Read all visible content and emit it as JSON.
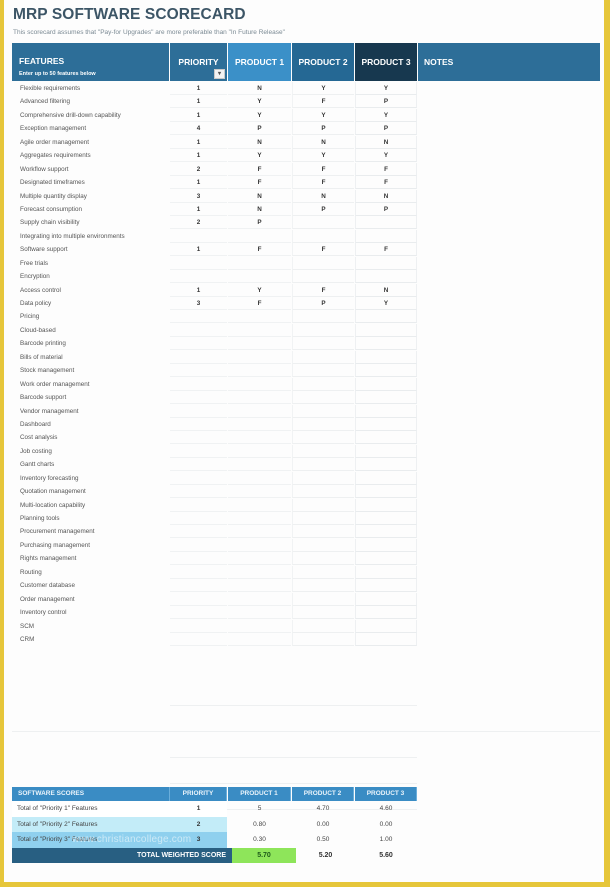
{
  "title": "MRP SOFTWARE SCORECARD",
  "subtitle": "This scorecard assumes that \"Pay-for Upgrades\" are more preferable than \"In Future Release\"",
  "header": {
    "features": "FEATURES",
    "features_sub": "Enter up to 50 features below",
    "priority": "PRIORITY",
    "filter_icon": "▾",
    "product1": "PRODUCT 1",
    "product2": "PRODUCT 2",
    "product3": "PRODUCT 3",
    "notes": "NOTES"
  },
  "colors": {
    "header_blue": "#2d6e98",
    "product1_blue": "#3b90c8",
    "product2_blue": "#256894",
    "product3_navy": "#17384f",
    "winner_green": "#8ee55a",
    "frame_yellow": "#e6c63a"
  },
  "features": [
    {
      "name": "Flexible requirements",
      "priority": "1",
      "p1": "N",
      "p2": "Y",
      "p3": "Y"
    },
    {
      "name": "Advanced filtering",
      "priority": "1",
      "p1": "Y",
      "p2": "F",
      "p3": "P"
    },
    {
      "name": "Comprehensive drill-down capability",
      "priority": "1",
      "p1": "Y",
      "p2": "Y",
      "p3": "Y"
    },
    {
      "name": "Exception management",
      "priority": "4",
      "p1": "P",
      "p2": "P",
      "p3": "P"
    },
    {
      "name": "Agile order management",
      "priority": "1",
      "p1": "N",
      "p2": "N",
      "p3": "N"
    },
    {
      "name": "Aggregates requirements",
      "priority": "1",
      "p1": "Y",
      "p2": "Y",
      "p3": "Y"
    },
    {
      "name": "Workflow support",
      "priority": "2",
      "p1": "F",
      "p2": "F",
      "p3": "F"
    },
    {
      "name": "Designated timeframes",
      "priority": "1",
      "p1": "F",
      "p2": "F",
      "p3": "F"
    },
    {
      "name": "Multiple quantity display",
      "priority": "3",
      "p1": "N",
      "p2": "N",
      "p3": "N"
    },
    {
      "name": "Forecast consumption",
      "priority": "1",
      "p1": "N",
      "p2": "P",
      "p3": "P"
    },
    {
      "name": "Supply chain visibility",
      "priority": "2",
      "p1": "P",
      "p2": "",
      "p3": ""
    },
    {
      "name": "Integrating into multiple environments",
      "priority": "",
      "p1": "",
      "p2": "",
      "p3": ""
    },
    {
      "name": "Software support",
      "priority": "1",
      "p1": "F",
      "p2": "F",
      "p3": "F"
    },
    {
      "name": "Free trials",
      "priority": "",
      "p1": "",
      "p2": "",
      "p3": ""
    },
    {
      "name": "Encryption",
      "priority": "",
      "p1": "",
      "p2": "",
      "p3": ""
    },
    {
      "name": "Access control",
      "priority": "1",
      "p1": "Y",
      "p2": "F",
      "p3": "N"
    },
    {
      "name": "Data policy",
      "priority": "3",
      "p1": "F",
      "p2": "P",
      "p3": "Y"
    },
    {
      "name": "Pricing",
      "priority": "",
      "p1": "",
      "p2": "",
      "p3": ""
    },
    {
      "name": "Cloud-based",
      "priority": "",
      "p1": "",
      "p2": "",
      "p3": ""
    },
    {
      "name": "Barcode printing",
      "priority": "",
      "p1": "",
      "p2": "",
      "p3": ""
    },
    {
      "name": "Bills of material",
      "priority": "",
      "p1": "",
      "p2": "",
      "p3": ""
    },
    {
      "name": "Stock management",
      "priority": "",
      "p1": "",
      "p2": "",
      "p3": ""
    },
    {
      "name": "Work order management",
      "priority": "",
      "p1": "",
      "p2": "",
      "p3": ""
    },
    {
      "name": "Barcode support",
      "priority": "",
      "p1": "",
      "p2": "",
      "p3": ""
    },
    {
      "name": "Vendor management",
      "priority": "",
      "p1": "",
      "p2": "",
      "p3": ""
    },
    {
      "name": "Dashboard",
      "priority": "",
      "p1": "",
      "p2": "",
      "p3": ""
    },
    {
      "name": "Cost analysis",
      "priority": "",
      "p1": "",
      "p2": "",
      "p3": ""
    },
    {
      "name": "Job costing",
      "priority": "",
      "p1": "",
      "p2": "",
      "p3": ""
    },
    {
      "name": "Gantt charts",
      "priority": "",
      "p1": "",
      "p2": "",
      "p3": ""
    },
    {
      "name": "Inventory forecasting",
      "priority": "",
      "p1": "",
      "p2": "",
      "p3": ""
    },
    {
      "name": "Quotation management",
      "priority": "",
      "p1": "",
      "p2": "",
      "p3": ""
    },
    {
      "name": "Multi-location capability",
      "priority": "",
      "p1": "",
      "p2": "",
      "p3": ""
    },
    {
      "name": "Planning tools",
      "priority": "",
      "p1": "",
      "p2": "",
      "p3": ""
    },
    {
      "name": "Procurement management",
      "priority": "",
      "p1": "",
      "p2": "",
      "p3": ""
    },
    {
      "name": "Purchasing management",
      "priority": "",
      "p1": "",
      "p2": "",
      "p3": ""
    },
    {
      "name": "Rights management",
      "priority": "",
      "p1": "",
      "p2": "",
      "p3": ""
    },
    {
      "name": "Routing",
      "priority": "",
      "p1": "",
      "p2": "",
      "p3": ""
    },
    {
      "name": "Customer database",
      "priority": "",
      "p1": "",
      "p2": "",
      "p3": ""
    },
    {
      "name": "Order management",
      "priority": "",
      "p1": "",
      "p2": "",
      "p3": ""
    },
    {
      "name": "Inventory control",
      "priority": "",
      "p1": "",
      "p2": "",
      "p3": ""
    },
    {
      "name": "SCM",
      "priority": "",
      "p1": "",
      "p2": "",
      "p3": ""
    },
    {
      "name": "CRM",
      "priority": "",
      "p1": "",
      "p2": "",
      "p3": ""
    }
  ],
  "scores": {
    "header": {
      "label": "SOFTWARE SCORES",
      "priority": "PRIORITY",
      "product1": "PRODUCT 1",
      "product2": "PRODUCT 2",
      "product3": "PRODUCT 3"
    },
    "rows": [
      {
        "label": "Total of \"Priority 1\" Features",
        "priority": "1",
        "p1": "5",
        "p2": "4.70",
        "p3": "4.60"
      },
      {
        "label": "Total of \"Priority 2\" Features",
        "priority": "2",
        "p1": "0.80",
        "p2": "0.00",
        "p3": "0.00"
      },
      {
        "label": "Total of \"Priority 3\" Features",
        "priority": "3",
        "p1": "0.30",
        "p2": "0.50",
        "p3": "1.00"
      }
    ],
    "total_label": "TOTAL WEIGHTED SCORE",
    "totals": {
      "p1": "5.70",
      "p2": "5.20",
      "p3": "5.60"
    }
  },
  "watermark": "www.christiancollege.com"
}
